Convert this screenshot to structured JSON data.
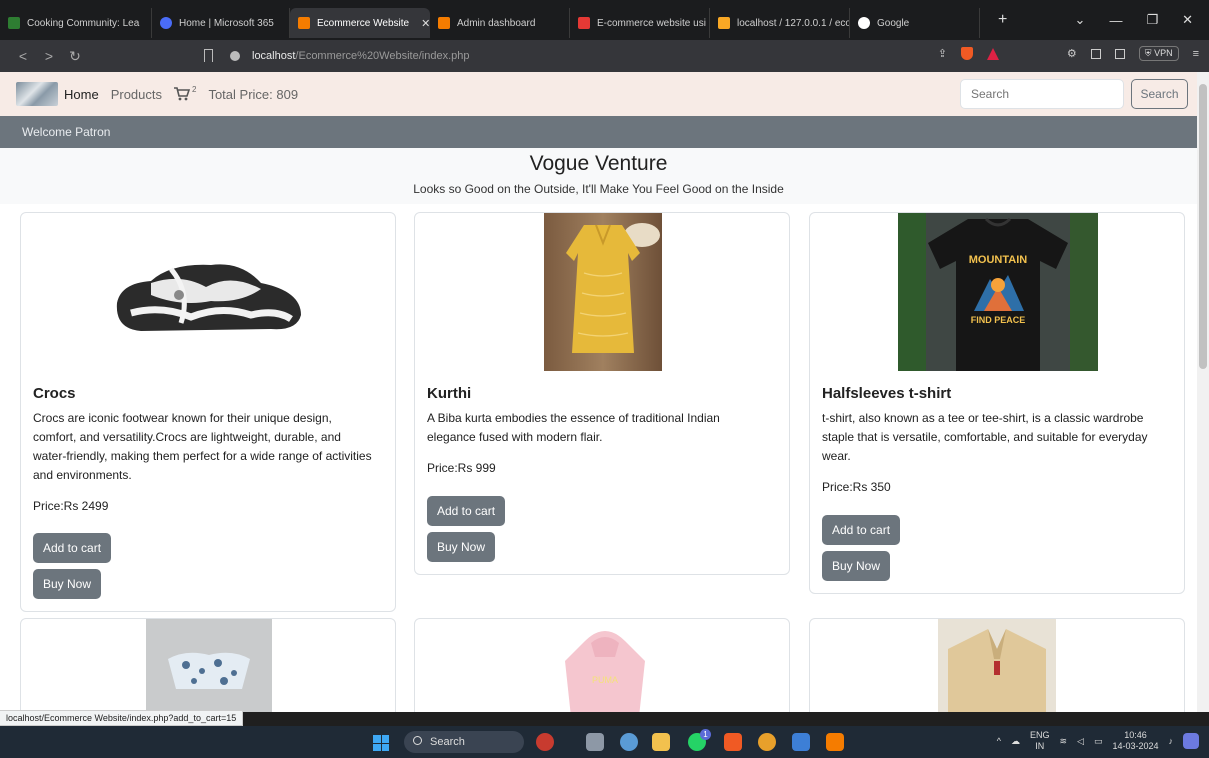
{
  "browser": {
    "tabs": [
      {
        "title": "Cooking Community: Lea",
        "color": "#2e7d32"
      },
      {
        "title": "Home | Microsoft 365",
        "color": "#4a6cf7"
      },
      {
        "title": "Ecommerce Website",
        "color": "#f57c00",
        "active": true
      },
      {
        "title": "Admin dashboard",
        "color": "#f57c00"
      },
      {
        "title": "E-commerce website usi",
        "color": "#e53935"
      },
      {
        "title": "localhost / 127.0.0.1 / eco",
        "color": "#f9a825"
      },
      {
        "title": "Google",
        "color": "#ffffff"
      }
    ],
    "close_tab": "✕",
    "new_tab": "+",
    "url_host": "localhost",
    "url_path": "/Ecommerce%20Website/index.php",
    "vpn_label": "VPN"
  },
  "navbar": {
    "home": "Home",
    "products": "Products",
    "cart_count": "2",
    "total_price": "Total Price: 809",
    "search_placeholder": "Search",
    "search_button": "Search"
  },
  "welcome": "Welcome Patron",
  "hero": {
    "title": "Vogue Venture",
    "tagline": "Looks so Good on the Outside, It'll Make You Feel Good on the Inside"
  },
  "products": [
    {
      "name": "Crocs",
      "description": "Crocs are iconic footwear known for their unique design, comfort, and versatility.Crocs are lightweight, durable, and water-friendly, making them perfect for a wide range of activities and environments.",
      "price": "Price:Rs 2499",
      "add_label": "Add to cart",
      "buy_label": "Buy Now"
    },
    {
      "name": "Kurthi",
      "description": "A Biba kurta embodies the essence of traditional Indian elegance fused with modern flair.",
      "price": "Price:Rs 999",
      "add_label": "Add to cart",
      "buy_label": "Buy Now"
    },
    {
      "name": "Halfsleeves t-shirt",
      "description": "t-shirt, also known as a tee or tee-shirt, is a classic wardrobe staple that is versatile, comfortable, and suitable for everyday wear.",
      "price": "Price:Rs 350",
      "add_label": "Add to cart",
      "buy_label": "Buy Now"
    }
  ],
  "tshirt_print": {
    "line1": "MOUNTAIN",
    "line2": "FIND PEACE"
  },
  "status_bar_url": "localhost/Ecommerce Website/index.php?add_to_cart=15",
  "taskbar": {
    "search_label": "Search",
    "lang": "ENG",
    "region": "IN",
    "time": "10:46",
    "date": "14-03-2024",
    "whatsapp_badge": "1"
  }
}
